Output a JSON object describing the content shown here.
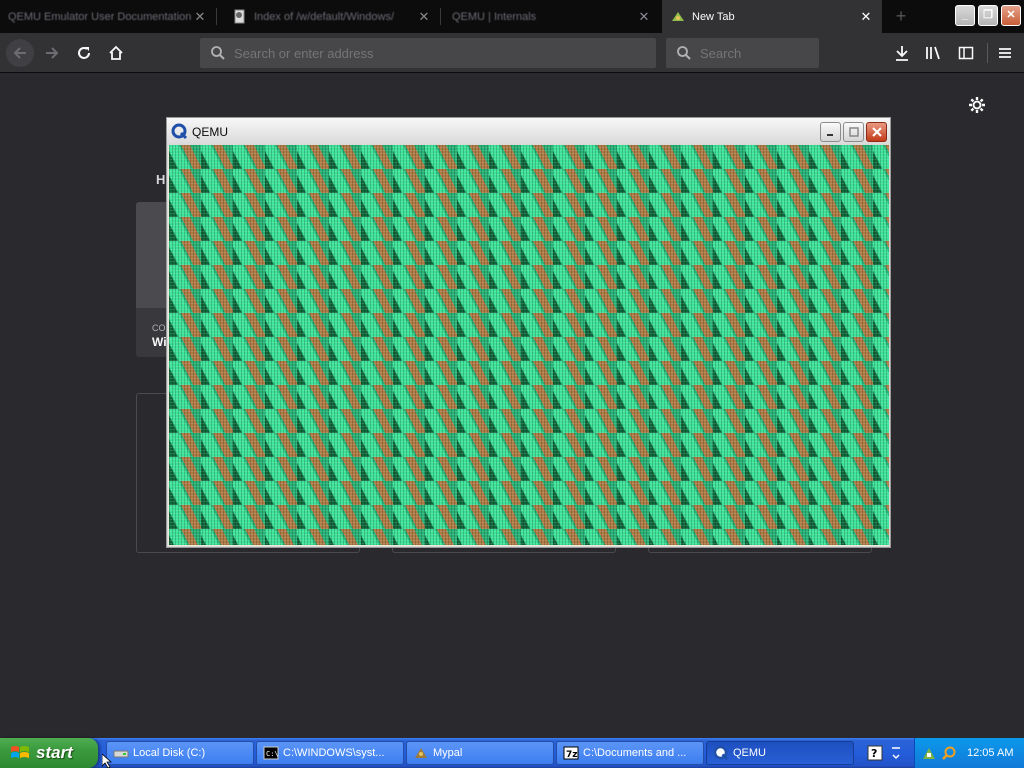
{
  "browser": {
    "tabs": [
      {
        "title": "QEMU Emulator User Documentation",
        "active": false
      },
      {
        "title": "Index of /w/default/Windows/",
        "active": false
      },
      {
        "title": "QEMU | Internals",
        "active": false
      },
      {
        "title": "New Tab",
        "active": true
      }
    ],
    "urlbar_placeholder": "Search or enter address",
    "searchbar_placeholder": "Search",
    "theme": {
      "frame": "#0c0c0d",
      "toolbar": "#323234",
      "field": "#474749",
      "page": "#2a2a2e"
    }
  },
  "newtab": {
    "section_heading": "H",
    "card": {
      "source": "CO",
      "title": "Wi"
    }
  },
  "qemu": {
    "title": "QEMU",
    "screen_colors": [
      "#27b276",
      "#3ee39a",
      "#10663b",
      "#b07c46"
    ]
  },
  "taskbar": {
    "start_label": "start",
    "tasks": [
      {
        "label": "Local Disk (C:)",
        "icon": "drive-icon",
        "active": false
      },
      {
        "label": "C:\\WINDOWS\\syst...",
        "icon": "cmd-icon",
        "active": false
      },
      {
        "label": "Mypal",
        "icon": "mypal-icon",
        "active": false
      },
      {
        "label": "C:\\Documents and ...",
        "icon": "7zip-icon",
        "active": false
      },
      {
        "label": "QEMU",
        "icon": "qemu-icon",
        "active": true
      }
    ],
    "clock": "12:05 AM"
  }
}
